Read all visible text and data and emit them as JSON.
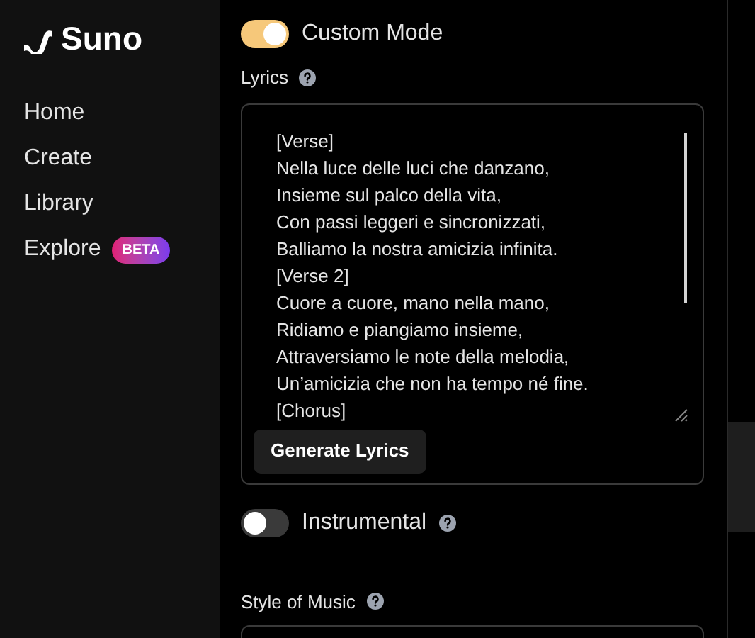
{
  "brand": {
    "name": "Suno"
  },
  "nav": [
    {
      "label": "Home"
    },
    {
      "label": "Create"
    },
    {
      "label": "Library"
    },
    {
      "label": "Explore",
      "badge": "BETA"
    }
  ],
  "custom_mode": {
    "label": "Custom Mode",
    "on": true
  },
  "lyrics": {
    "label": "Lyrics",
    "lines": [
      "[Verse]",
      "Nella luce delle luci che danzano,",
      "Insieme sul palco della vita,",
      "Con passi leggeri e sincronizzati,",
      "Balliamo la nostra amicizia infinita.",
      "[Verse 2]",
      "Cuore a cuore, mano nella mano,",
      "Ridiamo e piangiamo insieme,",
      "Attraversiamo le note della melodia,",
      "Un’amicizia che non ha tempo né fine.",
      "[Chorus]"
    ],
    "button": "Generate Lyrics"
  },
  "instrumental": {
    "label": "Instrumental",
    "on": false
  },
  "style_of_music": {
    "label": "Style of Music"
  }
}
